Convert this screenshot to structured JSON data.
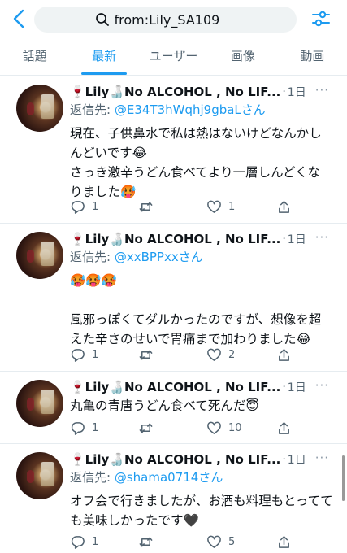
{
  "search": {
    "query": "from:Lily_SA109"
  },
  "tabs": [
    "話題",
    "最新",
    "ユーザー",
    "画像",
    "動画"
  ],
  "account": {
    "display_name": "🍷Lily🍶No ALCOHOL , No LIF...",
    "sep": "·",
    "more": "···"
  },
  "tweets": [
    {
      "time": "1日",
      "reply_label": "返信先:",
      "reply_handle": "@E34T3hWqhj9gbaLさん",
      "lines": [
        "現在、子供鼻水で私は熱はないけどなんかし",
        "んどいです😂",
        "さっき激辛うどん食べてより一層しんどくな",
        "りました🥵"
      ],
      "replies": "1",
      "retweets": "",
      "likes": "1"
    },
    {
      "time": "1日",
      "reply_label": "返信先:",
      "reply_handle": "@xxBPPxxさん",
      "lines": [
        "🥵🥵🥵",
        "",
        "風邪っぽくてダルかったのですが、想像を超",
        "えた辛さのせいで胃痛まで加わりました😂"
      ],
      "replies": "1",
      "retweets": "",
      "likes": "2"
    },
    {
      "time": "1日",
      "lines": [
        "丸亀の青唐うどん食べて死んだ😇"
      ],
      "replies": "1",
      "retweets": "",
      "likes": "10"
    },
    {
      "time": "1日",
      "reply_label": "返信先:",
      "reply_handle": "@shama0714さん",
      "lines": [
        "オフ会で行きましたが、お酒も料理もとってて",
        "も美味しかったです🖤"
      ],
      "replies": "1",
      "retweets": "",
      "likes": "5"
    }
  ],
  "colors": {
    "accent": "#1d9bf0",
    "muted": "#536471",
    "text": "#0f1419",
    "divider": "#e6ecf0"
  },
  "icons": [
    "back-arrow-icon",
    "search-icon",
    "filter-sliders-icon",
    "reply-icon",
    "retweet-icon",
    "like-heart-icon",
    "share-icon",
    "more-dots-icon"
  ]
}
